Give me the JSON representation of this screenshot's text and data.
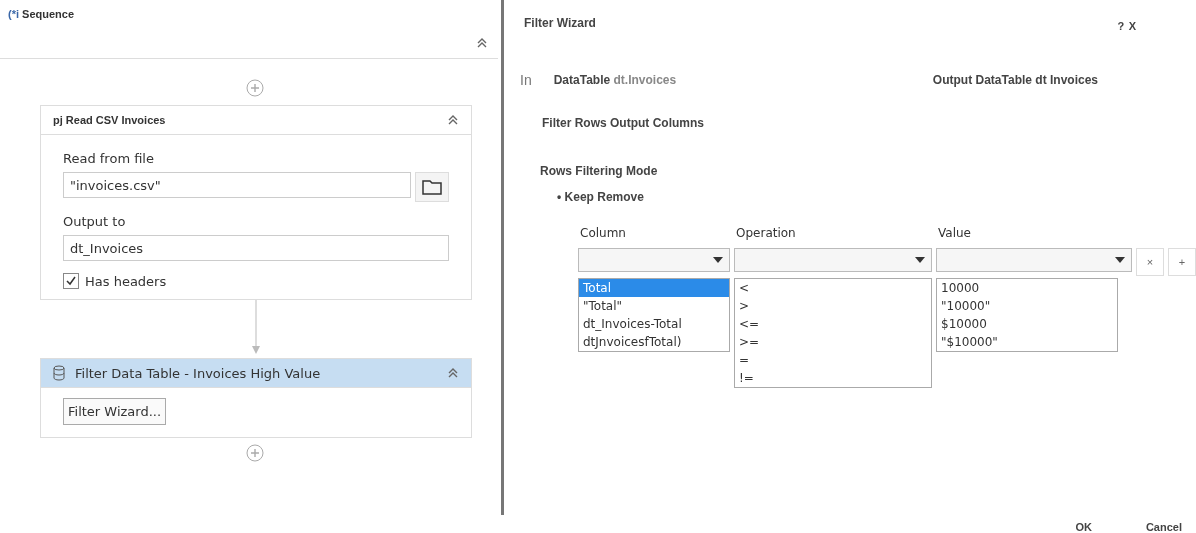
{
  "sequence": {
    "icon_text": "(*i",
    "title": "Sequence"
  },
  "read_csv": {
    "title": "pj Read CSV Invoices",
    "read_label": "Read from file",
    "file_value": "\"invoices.csv\"",
    "output_label": "Output to",
    "output_value": "dt_Invoices",
    "has_headers": {
      "label": "Has headers",
      "checked": true
    }
  },
  "filter_activity": {
    "title": "Filter Data Table - Invoices High Value",
    "selected": true,
    "button": "Filter Wizard..."
  },
  "dialog": {
    "title": "Filter Wizard",
    "help": "?",
    "close": "X",
    "tab_fragment": "In",
    "input_label": "DataTable",
    "input_value": "dt.Invoices",
    "output": "Output DataTable dt Invoices",
    "tabs": "Filter Rows Output Columns",
    "mode_label": "Rows Filtering Mode",
    "mode_options": "• Keep Remove",
    "headers": [
      "Column",
      "Operation",
      "Value"
    ],
    "column_options": [
      {
        "label": "Total",
        "selected": true
      },
      {
        "label": "\"Total\"",
        "selected": false
      },
      {
        "label": "dt_Invoices-Total",
        "selected": false
      },
      {
        "label": "dtJnvoicesfTotal)",
        "selected": false
      }
    ],
    "operation_options": [
      "<",
      ">",
      "<=",
      ">=",
      "=",
      "!="
    ],
    "value_options": [
      "10000",
      "\"10000\"",
      "$10000",
      "\"$10000\""
    ],
    "remove_button": "×",
    "add_button": "+",
    "ok": "OK",
    "cancel": "Cancel"
  }
}
